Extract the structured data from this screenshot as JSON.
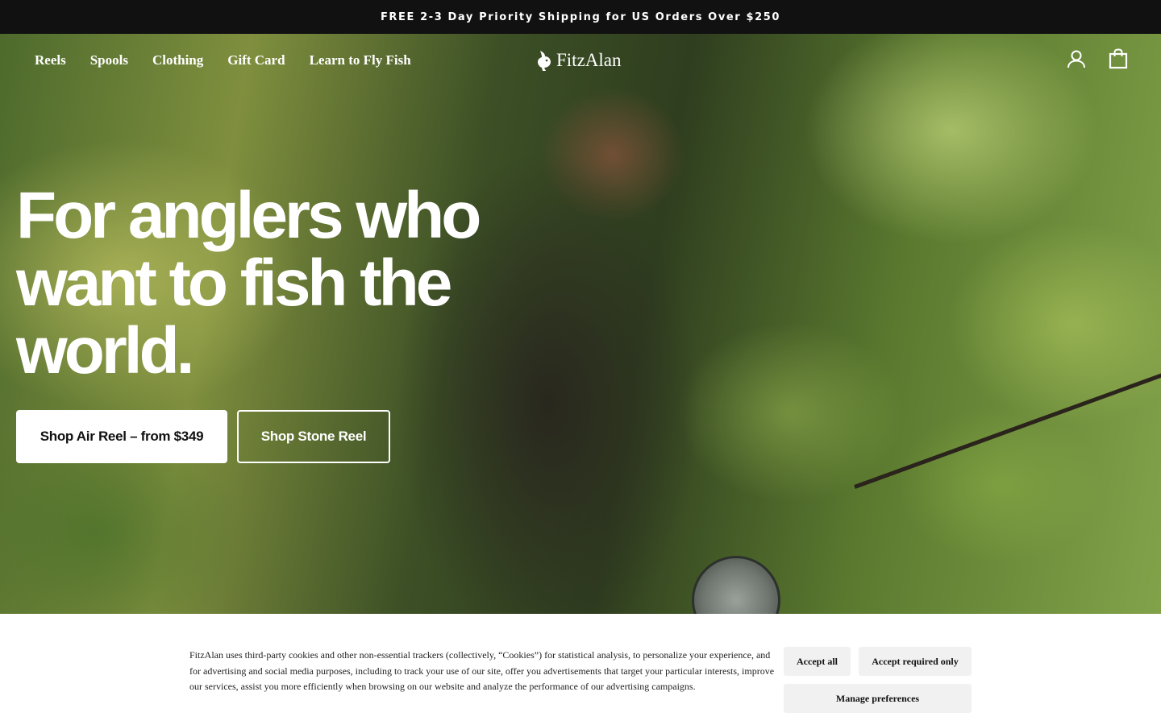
{
  "announcement": {
    "text": "FREE 2-3 Day Priority Shipping for US Orders Over $250"
  },
  "nav": {
    "links": [
      "Reels",
      "Spools",
      "Clothing",
      "Gift Card",
      "Learn to Fly Fish"
    ],
    "logo_text": "FitzAlan",
    "icons": [
      "account-icon",
      "cart-icon"
    ]
  },
  "hero": {
    "headline": "For anglers who want to fish the world.",
    "primary_cta": "Shop Air Reel – from $349",
    "secondary_cta": "Shop Stone Reel"
  },
  "cookie_banner": {
    "text": "FitzAlan uses third-party cookies and other non-essential trackers (collectively, “Cookies”) for statistical analysis, to personalize your experience, and for advertising and social media purposes, including to track your use of our site, offer you advertisements that target your particular interests, improve our services, assist you more efficiently when browsing on our website and analyze the performance of our advertising campaigns.",
    "accept_all": "Accept all",
    "accept_required": "Accept required only",
    "manage": "Manage preferences"
  },
  "colors": {
    "announcement_bg": "#111111",
    "text_light": "#ffffff",
    "cookie_button_bg": "#f1f1f1"
  }
}
